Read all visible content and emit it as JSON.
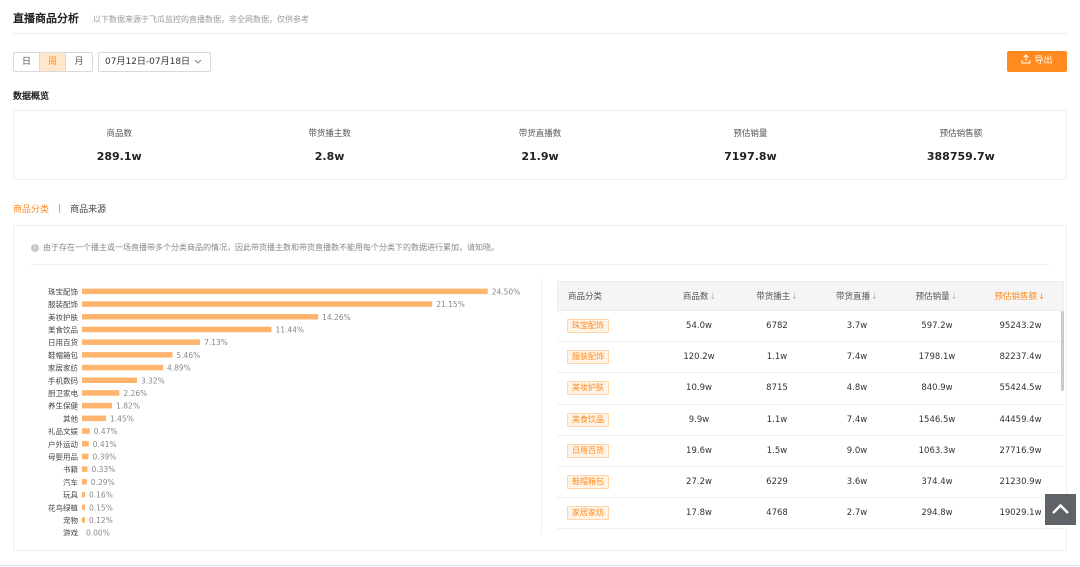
{
  "header": {
    "title": "直播商品分析",
    "subtitle": "以下数据来源于飞瓜监控的直播数据，非全网数据，仅供参考"
  },
  "toolbar": {
    "period_tabs": [
      "日",
      "周",
      "月"
    ],
    "active_period": "周",
    "date_range": "07月12日-07月18日",
    "export_label": "导出"
  },
  "overview": {
    "section_title": "数据概览",
    "items": [
      {
        "label": "商品数",
        "value": "289.1w"
      },
      {
        "label": "带货播主数",
        "value": "2.8w"
      },
      {
        "label": "带货直播数",
        "value": "21.9w"
      },
      {
        "label": "预估销量",
        "value": "7197.8w"
      },
      {
        "label": "预估销售额",
        "value": "388759.7w"
      }
    ]
  },
  "tabs": {
    "active": "商品分类",
    "separator": "|",
    "inactive": "商品来源"
  },
  "notice": "由于存在一个播主或一场直播带多个分类商品的情况，因此带货播主数和带货直播数不能用每个分类下的数据进行累加，请知晓。",
  "colors": {
    "accent": "#ff8a1f",
    "bar": "#ffb46e"
  },
  "icons": {
    "export": "upload-icon",
    "date": "chevron-down-icon",
    "notice": "info-icon",
    "back_to_top": "chevron-up-icon"
  },
  "chart_data": {
    "type": "bar",
    "orientation": "horizontal",
    "categories": [
      "珠宝配饰",
      "服装配饰",
      "美妆护肤",
      "美食饮品",
      "日用百货",
      "鞋帽箱包",
      "家居家纺",
      "手机数码",
      "厨卫家电",
      "养生保健",
      "其他",
      "礼品文娱",
      "户外运动",
      "母婴用品",
      "书籍",
      "汽车",
      "玩具",
      "花鸟绿植",
      "宠物",
      "游戏"
    ],
    "values": [
      24.5,
      21.15,
      14.26,
      11.44,
      7.13,
      5.46,
      4.89,
      3.32,
      2.26,
      1.82,
      1.45,
      0.47,
      0.41,
      0.39,
      0.33,
      0.29,
      0.16,
      0.15,
      0.12,
      0.0
    ],
    "labels": [
      "24.50%",
      "21.15%",
      "14.26%",
      "11.44%",
      "7.13%",
      "5.46%",
      "4.89%",
      "3.32%",
      "2.26%",
      "1.82%",
      "1.45%",
      "0.47%",
      "0.41%",
      "0.39%",
      "0.33%",
      "0.29%",
      "0.16%",
      "0.15%",
      "0.12%",
      "0.00%"
    ],
    "unit": "%",
    "xlim": [
      0,
      25
    ],
    "grid": false
  },
  "table": {
    "columns": [
      {
        "label": "商品分类",
        "sortable": false,
        "highlight": false
      },
      {
        "label": "商品数",
        "sortable": true,
        "highlight": false
      },
      {
        "label": "带货播主",
        "sortable": true,
        "highlight": false
      },
      {
        "label": "带货直播",
        "sortable": true,
        "highlight": false
      },
      {
        "label": "预估销量",
        "sortable": true,
        "highlight": false
      },
      {
        "label": "预估销售额",
        "sortable": true,
        "highlight": true
      }
    ],
    "sort_arrow": "↓",
    "rows": [
      [
        "珠宝配饰",
        "54.0w",
        "6782",
        "3.7w",
        "597.2w",
        "95243.2w"
      ],
      [
        "服装配饰",
        "120.2w",
        "1.1w",
        "7.4w",
        "1798.1w",
        "82237.4w"
      ],
      [
        "美妆护肤",
        "10.9w",
        "8715",
        "4.8w",
        "840.9w",
        "55424.5w"
      ],
      [
        "美食饮品",
        "9.9w",
        "1.1w",
        "7.4w",
        "1546.5w",
        "44459.4w"
      ],
      [
        "日用百货",
        "19.6w",
        "1.5w",
        "9.0w",
        "1063.3w",
        "27716.9w"
      ],
      [
        "鞋帽箱包",
        "27.2w",
        "6229",
        "3.6w",
        "374.4w",
        "21230.9w"
      ],
      [
        "家居家纺",
        "17.8w",
        "4768",
        "2.7w",
        "294.8w",
        "19029.1w"
      ]
    ]
  }
}
